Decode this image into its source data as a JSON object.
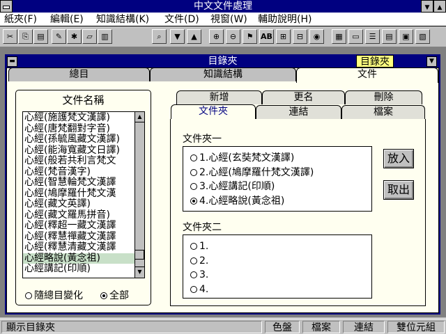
{
  "app": {
    "title": "中文文件處理"
  },
  "menu": [
    "紙夾(F)",
    "編輯(E)",
    "知識結構(K)",
    "文件(D)",
    "視窗(W)",
    "輔助說明(H)"
  ],
  "toolbar": {
    "buttons": [
      "cut-icon",
      "copy-icon",
      "paste-icon",
      "brush-icon",
      "scissor-icon",
      "box-icon",
      "open-book-icon",
      "find-icon",
      "down-arrow-icon",
      "up-arrow-icon",
      "zoom-in-icon",
      "zoom-out-icon",
      "tag-icon",
      "ab-icon",
      "tree-icon",
      "tree2-icon",
      "palette-icon",
      "doc1-icon",
      "folder-icon",
      "doc2-icon",
      "doc3-icon",
      "doc4-icon",
      "doc5-icon"
    ],
    "ab_label": "AB"
  },
  "child": {
    "title": "目錄夾",
    "tag": "目錄夾",
    "tabs": [
      "總目",
      "知識結構",
      "文件"
    ]
  },
  "left": {
    "title": "文件名稱",
    "items": [
      "心經(施護梵文漢譯)",
      "心經(唐梵翻對字音)",
      "心經(孫毓風藏文漢譯)",
      "心經(能海寬藏文日譯)",
      "心經(般若共利言梵文",
      "心經(梵音漢字)",
      "心經(智慧輪梵文漢譯",
      "心經(鳩摩羅什梵文漢",
      "心經(藏文英譯)",
      "心經(藏文羅馬拼音)",
      "心經(釋超一藏文漢譯",
      "心經(釋慧禪藏文漢譯",
      "心經(釋慧清藏文漢譯",
      "心經略說(黃念祖)",
      "心經講記(印順)"
    ],
    "selected_index": 13,
    "radio": [
      {
        "label": "隨總目變化",
        "on": false
      },
      {
        "label": "全部",
        "on": true
      }
    ]
  },
  "right": {
    "top_tabs": [
      "新增",
      "更名",
      "刪除"
    ],
    "tabs": [
      "文件夾",
      "連結",
      "檔案"
    ],
    "folder1": {
      "title": "文件夾一",
      "items": [
        {
          "label": "1.心經(玄奘梵文漢譯)",
          "on": false
        },
        {
          "label": "2.心經(鳩摩羅什梵文漢譯)",
          "on": false
        },
        {
          "label": "3.心經講記(印順)",
          "on": false
        },
        {
          "label": "4.心經略說(黃念祖)",
          "on": true
        }
      ]
    },
    "folder2": {
      "title": "文件夾二",
      "items": [
        {
          "label": "1.",
          "on": false
        },
        {
          "label": "2.",
          "on": false
        },
        {
          "label": "3.",
          "on": false
        },
        {
          "label": "4.",
          "on": false
        }
      ]
    },
    "btn_in": "放入",
    "btn_out": "取出"
  },
  "status": {
    "main": "顯示目錄夾",
    "panels": [
      "色盤",
      "檔案",
      "連結",
      "雙位元組"
    ]
  }
}
